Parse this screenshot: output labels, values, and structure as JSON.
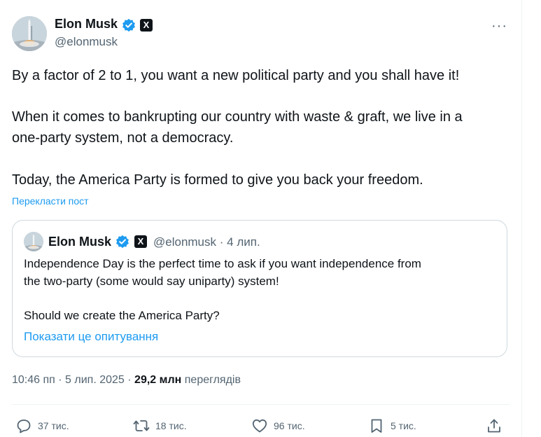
{
  "tweet": {
    "author_name": "Elon Musk",
    "handle": "@elonmusk",
    "x_badge": "X",
    "more_label": "···",
    "lines": [
      "By a factor of 2 to 1, you want a new political party and you shall have it!",
      "When it comes to bankrupting our country with waste & graft, we live in a",
      "one-party system, not a democracy.",
      "Today, the America Party is formed to give you back your freedom."
    ],
    "translate_label": "Перекласти пост"
  },
  "quote": {
    "author_name": "Elon Musk",
    "x_badge": "X",
    "handle": "@elonmusk",
    "separator": "·",
    "date": "4 лип.",
    "lines": [
      "Independence Day is the perfect time to ask if you want independence from",
      "the two-party (some would say uniparty) system!",
      "Should we create the America Party?"
    ],
    "poll_label": "Показати це опитування"
  },
  "meta": {
    "time": "10:46 пп",
    "date": "5 лип. 2025",
    "views_count": "29,2 млн",
    "views_label": "переглядів"
  },
  "actions": {
    "replies": "37 тис.",
    "reposts": "18 тис.",
    "likes": "96 тис.",
    "bookmarks": "5 тис."
  },
  "colors": {
    "accent": "#1d9bf0",
    "secondary_text": "#536471",
    "primary_text": "#0f1419",
    "border": "#cfd9de"
  },
  "icons": [
    "verified-badge-icon",
    "x-logo-icon",
    "more-icon",
    "reply-icon",
    "repost-icon",
    "like-icon",
    "bookmark-icon",
    "share-icon"
  ]
}
